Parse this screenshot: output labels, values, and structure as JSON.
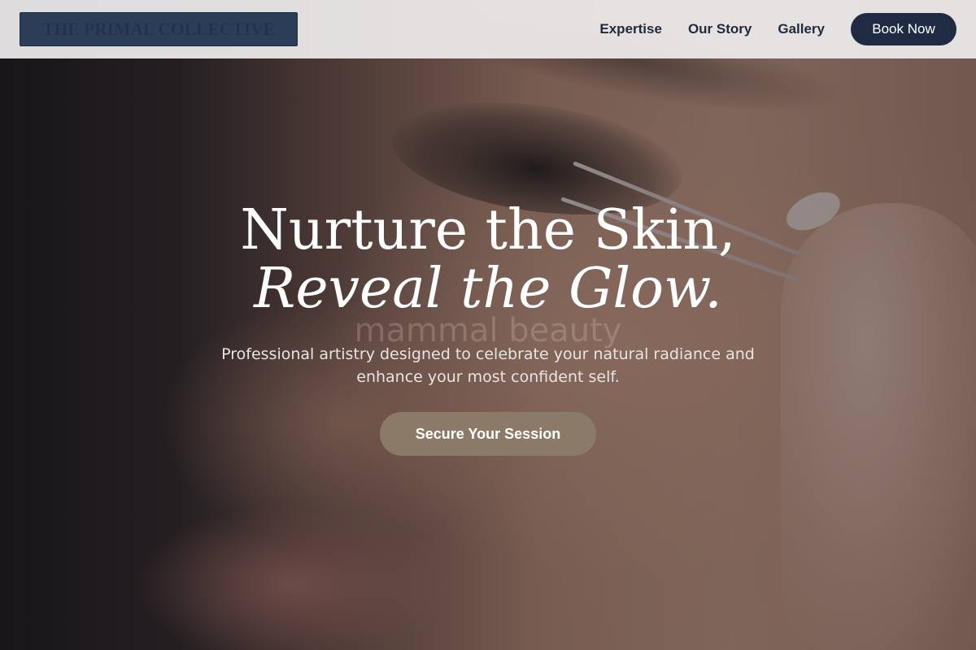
{
  "header": {
    "logo_text": "THE PRIMAL COLLECTIVE",
    "nav": [
      {
        "label": "Expertise"
      },
      {
        "label": "Our Story"
      },
      {
        "label": "Gallery"
      }
    ],
    "cta_label": "Book Now"
  },
  "hero": {
    "headline_line1": "Nurture the Skin,",
    "headline_line2": "Reveal the Glow.",
    "watermark_text": "mammal beauty",
    "subtext": "Professional artistry designed to celebrate your natural radiance and enhance your most confident self.",
    "cta_label": "Secure Your Session",
    "image_subject": "close-up of eyelash tweezers application"
  },
  "colors": {
    "navy": "#1e2b43",
    "accent_taupe": "#8b7a68",
    "nav_bg": "#eeecec"
  }
}
